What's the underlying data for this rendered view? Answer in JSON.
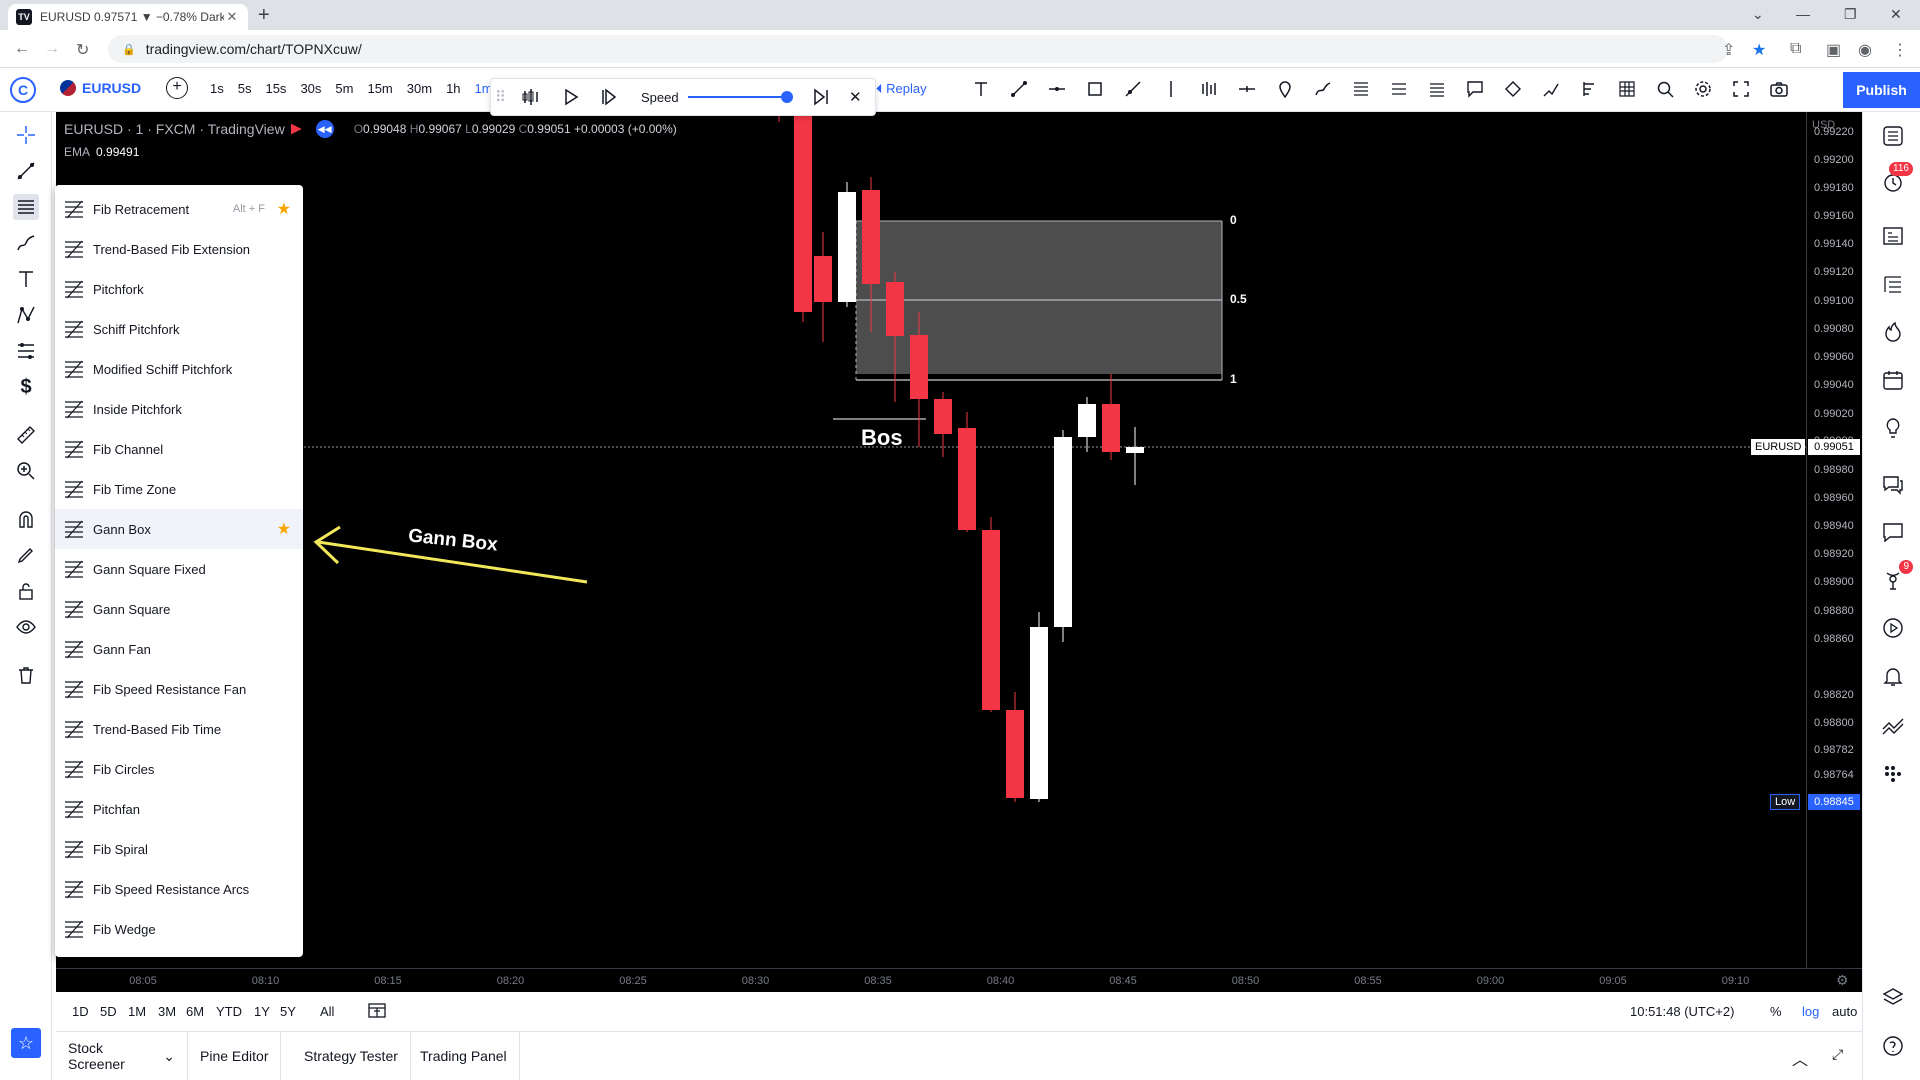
{
  "browser": {
    "tab_title": "EURUSD 0.97571 ▼ −0.78% Dark",
    "url": "tradingview.com/chart/TOPNXcuw/"
  },
  "toolbar": {
    "avatar_letter": "C",
    "symbol": "EURUSD",
    "timeframes": [
      "1s",
      "5s",
      "15s",
      "30s",
      "5m",
      "15m",
      "30m",
      "1h",
      "1m"
    ],
    "active_timeframe": "1m",
    "speed_label": "Speed",
    "replay_label": "Replay",
    "publish_label": "Publish"
  },
  "chart": {
    "title": "EURUSD · 1 · FXCM · TradingView",
    "ohlc": {
      "o": "0.99048",
      "h": "0.99067",
      "l": "0.99029",
      "c": "0.99051",
      "chg": "+0.00003 (+0.00%)"
    },
    "ema_label": "EMA",
    "ema_value": "0.99491",
    "currency": "USD",
    "price_ticks": [
      "0.99220",
      "0.99200",
      "0.99180",
      "0.99160",
      "0.99140",
      "0.99120",
      "0.99100",
      "0.99080",
      "0.99060",
      "0.99040",
      "0.99020",
      "0.99000",
      "0.98980",
      "0.98960",
      "0.98940",
      "0.98920",
      "0.98900",
      "0.98880",
      "0.98860",
      "0.98845",
      "0.98820",
      "0.98800",
      "0.98782",
      "0.98764"
    ],
    "current_symbol": "EURUSD",
    "current_price": "0.99051",
    "low_label": "Low",
    "low_price": "0.98845",
    "time_ticks": [
      "08:05",
      "08:10",
      "08:15",
      "08:20",
      "08:25",
      "08:30",
      "08:35",
      "08:40",
      "08:45",
      "08:50",
      "08:55",
      "09:00",
      "09:05",
      "09:10"
    ],
    "fib_levels": [
      "0",
      "0.5",
      "1"
    ],
    "annotation_bos": "Bos",
    "annotation_gann": "Gann Box"
  },
  "fib_menu": [
    {
      "label": "Fib Retracement",
      "hotkey": "Alt + F",
      "fav": true
    },
    {
      "label": "Trend-Based Fib Extension"
    },
    {
      "label": "Pitchfork"
    },
    {
      "label": "Schiff Pitchfork"
    },
    {
      "label": "Modified Schiff Pitchfork"
    },
    {
      "label": "Inside Pitchfork"
    },
    {
      "label": "Fib Channel"
    },
    {
      "label": "Fib Time Zone"
    },
    {
      "label": "Gann Box",
      "fav": true
    },
    {
      "label": "Gann Square Fixed"
    },
    {
      "label": "Gann Square"
    },
    {
      "label": "Gann Fan"
    },
    {
      "label": "Fib Speed Resistance Fan"
    },
    {
      "label": "Trend-Based Fib Time"
    },
    {
      "label": "Fib Circles"
    },
    {
      "label": "Pitchfan"
    },
    {
      "label": "Fib Spiral"
    },
    {
      "label": "Fib Speed Resistance Arcs"
    },
    {
      "label": "Fib Wedge"
    }
  ],
  "range": {
    "buttons": [
      "1D",
      "5D",
      "1M",
      "3M",
      "6M",
      "YTD",
      "1Y",
      "5Y",
      "All"
    ],
    "clock": "10:51:48 (UTC+2)",
    "percent": "%",
    "log": "log",
    "auto": "auto"
  },
  "bottom_tabs": [
    "Stock Screener",
    "Pine Editor",
    "Strategy Tester",
    "Trading Panel"
  ],
  "badges": {
    "alerts": "116",
    "notifications": "9"
  },
  "colors": {
    "accent": "#2962ff",
    "bear": "#f23645",
    "bull": "#ffffff",
    "chart_bg": "#000000",
    "star": "#f7a600"
  }
}
